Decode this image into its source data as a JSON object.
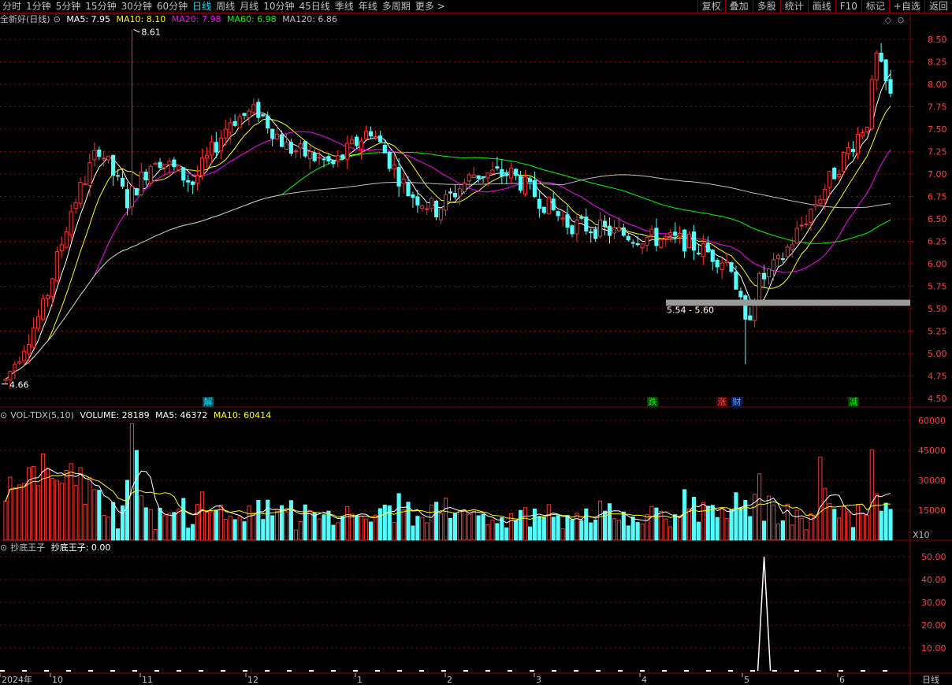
{
  "toolbar": {
    "periods": [
      "分时",
      "1分钟",
      "5分钟",
      "15分钟",
      "30分钟",
      "60分钟",
      "日线",
      "周线",
      "月线",
      "10分钟",
      "45日线",
      "季线",
      "年线",
      "多周期",
      "更多 >"
    ],
    "active": "日线",
    "right": [
      "复权",
      "叠加",
      "多股",
      "统计",
      "画线",
      "F10",
      "标记",
      "+自选",
      "返回"
    ]
  },
  "price_legend": {
    "stock": "全新好(日线)",
    "ma5": "MA5: 7.95",
    "ma10": "MA10: 8.10",
    "ma20": "MA20: 7.98",
    "ma60": "MA60: 6.98",
    "ma120": "MA120: 6.86"
  },
  "vol_legend": {
    "name": "VOL-TDX(5,10)",
    "volume": "VOLUME: 28189",
    "ma5": "MA5: 46372",
    "ma10": "MA10: 60414"
  },
  "ind_legend": {
    "name": "抄底王子",
    "value": "抄底王子: 0.00"
  },
  "annotations": {
    "high": "8.61",
    "low": "4.66",
    "range": "5.54 - 5.60",
    "events": [
      "解",
      "跌",
      "涨",
      "财",
      "减"
    ]
  },
  "colors": {
    "up": "#ff3232",
    "down": "#54fcfc",
    "ma5": "#ffffff",
    "ma10": "#ffff00",
    "ma20": "#ff00ff",
    "ma60": "#00ff00",
    "ma120": "#c0c0c0",
    "grid": "#8b0000"
  },
  "price_axis": [
    "8.50",
    "8.25",
    "8.00",
    "7.75",
    "7.50",
    "7.25",
    "7.00",
    "6.75",
    "6.50",
    "6.25",
    "6.00",
    "5.75",
    "5.50",
    "5.25",
    "5.00",
    "4.75",
    "4.50"
  ],
  "vol_axis": [
    "60000",
    "45000",
    "30000",
    "15000"
  ],
  "vol_unit": "X10",
  "ind_axis": [
    "50.00",
    "40.00",
    "30.00",
    "20.00",
    "10.00"
  ],
  "date_axis": [
    "2024年",
    "10",
    "11",
    "12",
    "1",
    "2",
    "3",
    "4",
    "5",
    "6"
  ],
  "period_label": "日线",
  "chart_data": {
    "type": "candlestick",
    "price_ylim": [
      4.5,
      8.6
    ],
    "price_high": 8.61,
    "price_low": 4.66,
    "support_zone": [
      5.54,
      5.6
    ],
    "ma_last": {
      "ma5": 7.95,
      "ma10": 8.1,
      "ma20": 7.98,
      "ma60": 6.98,
      "ma120": 6.86
    },
    "volume_last": 28189,
    "volume_ma5": 46372,
    "volume_ma10": 60414,
    "indicator_peak": 50,
    "indicator_last": 0.0
  }
}
